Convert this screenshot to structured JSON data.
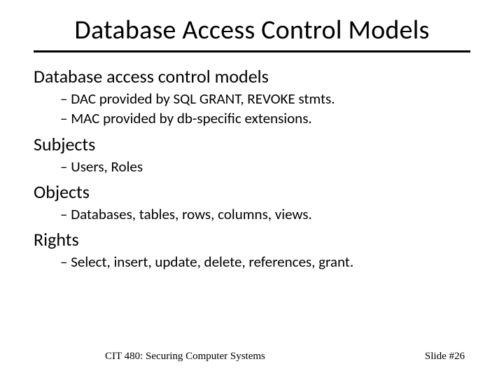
{
  "title": "Database Access Control Models",
  "sections": [
    {
      "heading": "Database access control models",
      "bullets": [
        "DAC provided by SQL GRANT, REVOKE stmts.",
        "MAC provided by db-specific extensions."
      ]
    },
    {
      "heading": "Subjects",
      "bullets": [
        "Users, Roles"
      ]
    },
    {
      "heading": "Objects",
      "bullets": [
        "Databases, tables, rows, columns, views."
      ]
    },
    {
      "heading": "Rights",
      "bullets": [
        "Select, insert, update, delete, references, grant."
      ]
    }
  ],
  "footer": {
    "course": "CIT 480: Securing Computer Systems",
    "slide_number": "Slide #26"
  }
}
